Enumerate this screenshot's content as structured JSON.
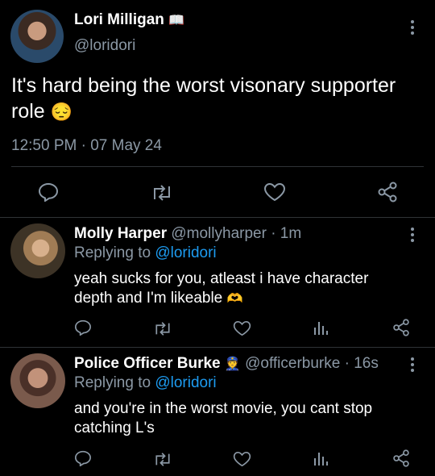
{
  "main_tweet": {
    "author_name": "Lori Milligan",
    "author_badge": "📖",
    "handle": "@loridori",
    "text_line1": "It's hard being the worst visonary supporter",
    "text_line2": "role",
    "text_emoji": "😔",
    "timestamp": "12:50 PM · 07 May 24"
  },
  "replies": [
    {
      "author_name": "Molly Harper",
      "handle_time": "@mollyharper · 1m",
      "replying_label": "Replying to",
      "replying_handle": "@loridori",
      "text_line1": "yeah sucks for you, atleast i have character",
      "text_line2": "depth and I'm likeable",
      "text_emoji": "🫶"
    },
    {
      "author_name": "Police Officer Burke",
      "author_badge": "👮",
      "handle_time": "@officerburke · 16s",
      "replying_label": "Replying to",
      "replying_handle": "@loridori",
      "text_line1": "and you're in the worst movie, you cant stop",
      "text_line2": "catching L's"
    }
  ],
  "icons": [
    "reply-icon",
    "retweet-icon",
    "like-icon",
    "share-icon",
    "views-icon",
    "more-icon"
  ],
  "colors": {
    "background": "#000000",
    "text": "#ffffff",
    "secondary": "#8b98a5",
    "link": "#1d9bf0",
    "divider": "#2f3336"
  }
}
